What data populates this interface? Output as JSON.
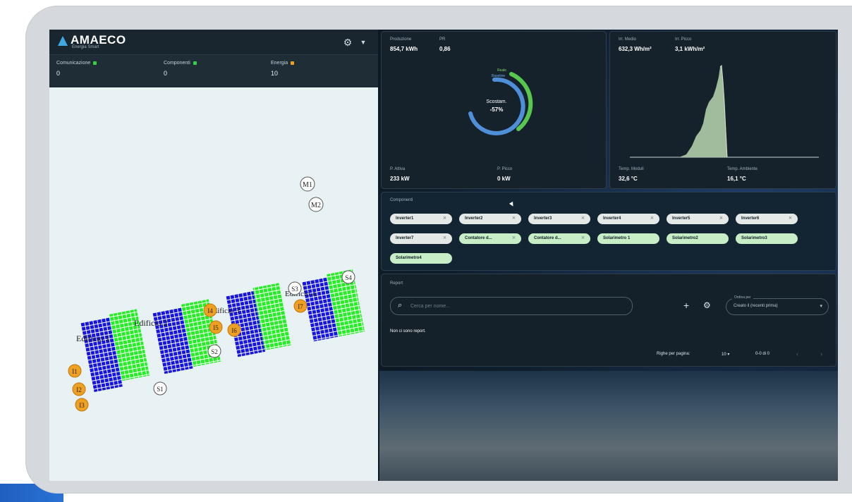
{
  "app": {
    "logo": "AMAECO",
    "logo_sub": "Energia Smart"
  },
  "status": {
    "items": [
      {
        "label": "Comunicazione",
        "value": "0",
        "color": "#37d043"
      },
      {
        "label": "Componenti",
        "value": "0",
        "color": "#37d043"
      },
      {
        "label": "Energia",
        "value": "10",
        "color": "#f0a020"
      }
    ]
  },
  "map": {
    "buildings": [
      "Edificio 1",
      "Edificio 2",
      "Edificio 3",
      "Edificio 4"
    ],
    "inverters": [
      "I1",
      "I2",
      "I3",
      "I4",
      "I5",
      "I6",
      "I7"
    ],
    "strings": [
      "S1",
      "S2",
      "S3",
      "S4"
    ],
    "meters": [
      "M1",
      "M2"
    ],
    "colors": {
      "panel_blue": "#1414e6",
      "panel_green": "#22f022",
      "inverter": "#f0a020"
    }
  },
  "production": {
    "label1": "Produzione",
    "value1": "854,7 kWh",
    "label2": "PR",
    "value2": "0,86",
    "gauge_legend1": "Reale",
    "gauge_legend2": "Baseline",
    "gauge_title": "Scostam.",
    "gauge_value": "-57%",
    "label3": "P. Attiva",
    "value3": "233 kW",
    "label4": "P. Picco",
    "value4": "0 kW"
  },
  "irradiance": {
    "label1": "Irr. Medio",
    "value1": "632,3 Wh/m²",
    "label2": "Irr. Picco",
    "value2": "3,1 kWh/m²",
    "label3": "Temp. Moduli",
    "value3": "32,6 °C",
    "label4": "Temp. Ambiente",
    "value4": "16,1 °C"
  },
  "components": {
    "title": "Componenti",
    "chips": [
      {
        "label": "Inverter1",
        "style": "light"
      },
      {
        "label": "Inverter2",
        "style": "light"
      },
      {
        "label": "Inverter3",
        "style": "light"
      },
      {
        "label": "Inverter4",
        "style": "light"
      },
      {
        "label": "Inverter5",
        "style": "light"
      },
      {
        "label": "Inverter6",
        "style": "light"
      },
      {
        "label": "Inverter7",
        "style": "light"
      },
      {
        "label": "Contatore d...",
        "style": "green"
      },
      {
        "label": "Contatore d...",
        "style": "green"
      },
      {
        "label": "Solarimetro 1",
        "style": "green"
      },
      {
        "label": "Solarimetro2",
        "style": "green"
      },
      {
        "label": "Solarimetro3",
        "style": "green"
      },
      {
        "label": "Solarimetro4",
        "style": "green"
      }
    ]
  },
  "report": {
    "title": "Report",
    "search_placeholder": "Cerca per nome...",
    "sort_legend": "Ordina per",
    "sort_value": "Creato il (recenti prima)",
    "empty": "Non ci sono report.",
    "rows_label": "Righe per pagina:",
    "rows_value": "10",
    "range": "0-0 di 0"
  }
}
